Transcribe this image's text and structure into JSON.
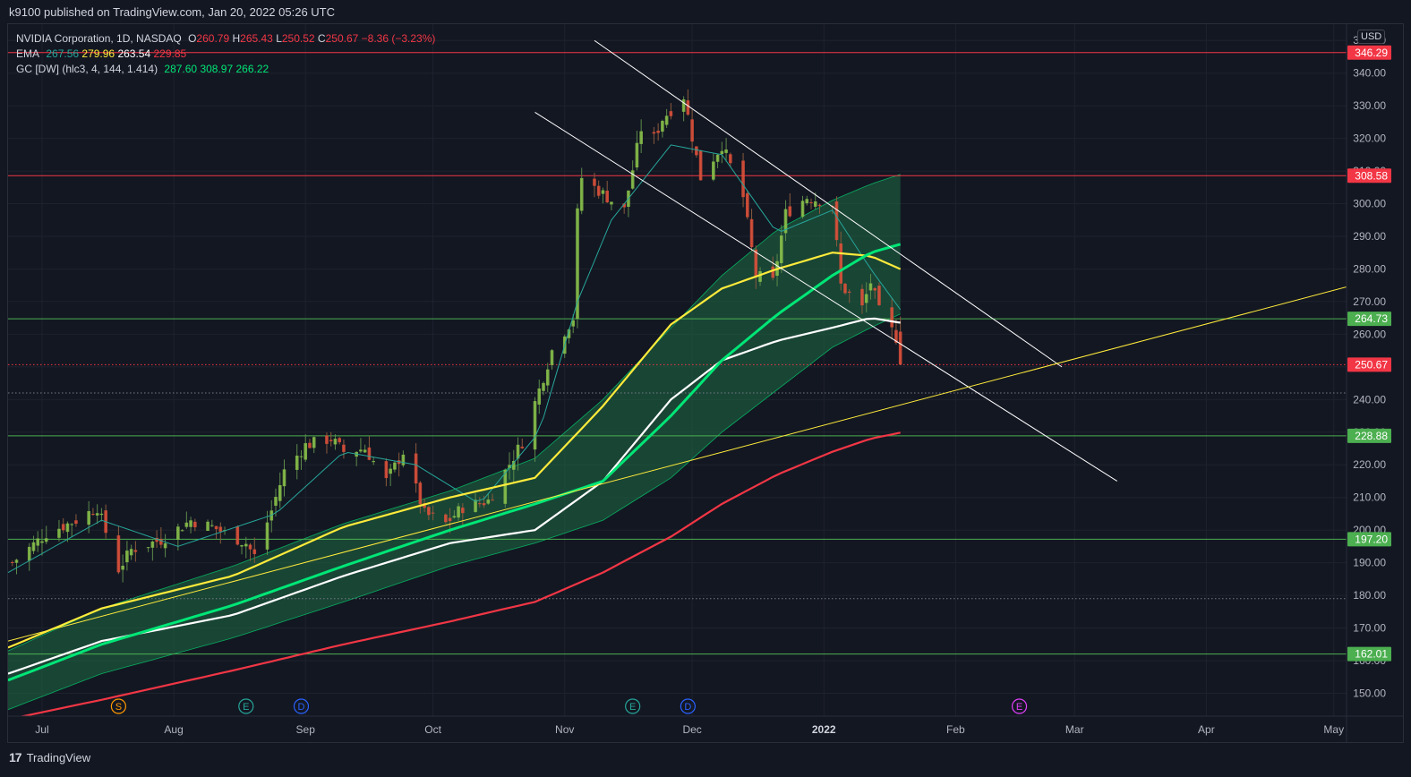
{
  "publish_line": "k9100 published on TradingView.com, Jan 20, 2022 05:26 UTC",
  "currency_badge": "USD",
  "legend": {
    "symbol_line": {
      "name": "NVIDIA Corporation, 1D, NASDAQ",
      "open_label": "O",
      "open": "260.79",
      "high_label": "H",
      "high": "265.43",
      "low_label": "L",
      "low": "250.52",
      "close_label": "C",
      "close": "250.67",
      "change": "−8.36 (−3.23%)"
    },
    "ema": {
      "label": "EMA",
      "values": [
        "267.56",
        "279.96",
        "263.54",
        "229.85"
      ]
    },
    "gc": {
      "label": "GC [DW] (hlc3, 4, 144, 1.414)",
      "values": [
        "287.60",
        "308.97",
        "266.22"
      ]
    }
  },
  "colors": {
    "up": "#4caf50",
    "down": "#f23645",
    "ema_fast": "#26a69a",
    "ema_yellow": "#ffeb3b",
    "ema_white": "#ffffff",
    "ema_red": "#f23645",
    "gc_mid": "#00e676",
    "band_fill": "#1b5e3a",
    "hline_red": "#f23645",
    "hline_green": "#4caf50",
    "trend_white": "#ffffff",
    "trend_yellow": "#ffeb3b"
  },
  "footer": {
    "brand": "TradingView"
  },
  "chart_data": {
    "type": "candlestick",
    "y_axis": {
      "range": [
        143,
        355
      ],
      "ticks": [
        "150.00",
        "160.00",
        "170.00",
        "180.00",
        "190.00",
        "200.00",
        "210.00",
        "220.00",
        "230.00",
        "240.00",
        "250.00",
        "260.00",
        "270.00",
        "280.00",
        "290.00",
        "300.00",
        "310.00",
        "320.00",
        "330.00",
        "340.00",
        "350.00"
      ],
      "tick_values": [
        150,
        160,
        170,
        180,
        190,
        200,
        210,
        220,
        230,
        240,
        250,
        260,
        270,
        280,
        290,
        300,
        310,
        320,
        330,
        340,
        350
      ]
    },
    "x_axis": {
      "labels": [
        "Jul",
        "Aug",
        "Sep",
        "Oct",
        "Nov",
        "Dec",
        "2022",
        "Feb",
        "Mar",
        "Apr",
        "May"
      ],
      "label_dates": [
        "2021-07-01",
        "2021-08-01",
        "2021-09-01",
        "2021-10-01",
        "2021-11-01",
        "2021-12-01",
        "2022-01-01",
        "2022-02-01",
        "2022-03-01",
        "2022-04-01",
        "2022-05-01"
      ],
      "range": [
        "2021-06-23",
        "2022-05-04"
      ]
    },
    "price_labels": [
      {
        "value": 346.29,
        "text": "346.29",
        "color": "#f23645"
      },
      {
        "value": 308.58,
        "text": "308.58",
        "color": "#f23645"
      },
      {
        "value": 264.73,
        "text": "264.73",
        "color": "#4caf50"
      },
      {
        "value": 250.67,
        "text": "250.67",
        "color": "#f23645"
      },
      {
        "value": 228.88,
        "text": "228.88",
        "color": "#4caf50"
      },
      {
        "value": 197.2,
        "text": "197.20",
        "color": "#4caf50"
      },
      {
        "value": 162.01,
        "text": "162.01",
        "color": "#4caf50"
      }
    ],
    "horizontal_lines": [
      {
        "value": 346.29,
        "color": "#f23645",
        "style": "solid"
      },
      {
        "value": 308.58,
        "color": "#f23645",
        "style": "solid"
      },
      {
        "value": 264.73,
        "color": "#4caf50",
        "style": "solid"
      },
      {
        "value": 250.67,
        "color": "#f23645",
        "style": "dotted"
      },
      {
        "value": 228.88,
        "color": "#4caf50",
        "style": "solid"
      },
      {
        "value": 197.2,
        "color": "#4caf50",
        "style": "solid"
      },
      {
        "value": 162.01,
        "color": "#4caf50",
        "style": "solid"
      },
      {
        "value": 242,
        "color": "#787b86",
        "style": "dotted"
      },
      {
        "value": 179,
        "color": "#787b86",
        "style": "dotted"
      }
    ],
    "trend_lines": [
      {
        "from": [
          "2021-11-08",
          350
        ],
        "to": [
          "2022-02-26",
          250
        ],
        "color": "#ffffff"
      },
      {
        "from": [
          "2021-10-25",
          328
        ],
        "to": [
          "2022-03-11",
          215
        ],
        "color": "#ffffff"
      },
      {
        "from": [
          "2021-06-23",
          166
        ],
        "to": [
          "2022-05-04",
          274.5
        ],
        "color": "#ffeb3b"
      }
    ],
    "close_anchors": [
      [
        "2021-06-24",
        190
      ],
      [
        "2021-07-02",
        199
      ],
      [
        "2021-07-09",
        203
      ],
      [
        "2021-07-14",
        207
      ],
      [
        "2021-07-19",
        188
      ],
      [
        "2021-07-22",
        194
      ],
      [
        "2021-07-29",
        197
      ],
      [
        "2021-08-05",
        203
      ],
      [
        "2021-08-10",
        201
      ],
      [
        "2021-08-18",
        196
      ],
      [
        "2021-08-20",
        192
      ],
      [
        "2021-08-24",
        206
      ],
      [
        "2021-08-27",
        218
      ],
      [
        "2021-09-01",
        226
      ],
      [
        "2021-09-07",
        228
      ],
      [
        "2021-09-10",
        224
      ],
      [
        "2021-09-15",
        225
      ],
      [
        "2021-09-20",
        215
      ],
      [
        "2021-09-24",
        224
      ],
      [
        "2021-09-29",
        205
      ],
      [
        "2021-10-04",
        202
      ],
      [
        "2021-10-08",
        207
      ],
      [
        "2021-10-14",
        209
      ],
      [
        "2021-10-18",
        218
      ],
      [
        "2021-10-22",
        227
      ],
      [
        "2021-10-29",
        255
      ],
      [
        "2021-11-03",
        265
      ],
      [
        "2021-11-04",
        297
      ],
      [
        "2021-11-05",
        308
      ],
      [
        "2021-11-10",
        303
      ],
      [
        "2021-11-15",
        298
      ],
      [
        "2021-11-19",
        323
      ],
      [
        "2021-11-22",
        320
      ],
      [
        "2021-11-24",
        326
      ],
      [
        "2021-11-29",
        333
      ],
      [
        "2021-12-03",
        308
      ],
      [
        "2021-12-08",
        318
      ],
      [
        "2021-12-13",
        302
      ],
      [
        "2021-12-16",
        278
      ],
      [
        "2021-12-20",
        276
      ],
      [
        "2021-12-23",
        297
      ],
      [
        "2021-12-28",
        302
      ],
      [
        "2022-01-03",
        300
      ],
      [
        "2022-01-05",
        275
      ],
      [
        "2022-01-10",
        268
      ],
      [
        "2022-01-12",
        276
      ],
      [
        "2022-01-14",
        267
      ],
      [
        "2022-01-18",
        259
      ],
      [
        "2022-01-19",
        250.67
      ]
    ],
    "ema_series": [
      {
        "name": "EMA 1",
        "color": "#26a69a",
        "values": [
          [
            "2021-06-23",
            187
          ],
          [
            "2021-07-15",
            203
          ],
          [
            "2021-08-02",
            195
          ],
          [
            "2021-08-25",
            205
          ],
          [
            "2021-09-10",
            224
          ],
          [
            "2021-09-27",
            220
          ],
          [
            "2021-10-12",
            208
          ],
          [
            "2021-10-26",
            230
          ],
          [
            "2021-11-04",
            270
          ],
          [
            "2021-11-12",
            295
          ],
          [
            "2021-11-26",
            318
          ],
          [
            "2021-12-08",
            315
          ],
          [
            "2021-12-21",
            291
          ],
          [
            "2022-01-03",
            298
          ],
          [
            "2022-01-12",
            280
          ],
          [
            "2022-01-19",
            267.56
          ]
        ]
      },
      {
        "name": "EMA 2",
        "color": "#ffeb3b",
        "values": [
          [
            "2021-06-23",
            164
          ],
          [
            "2021-07-15",
            176
          ],
          [
            "2021-08-15",
            186
          ],
          [
            "2021-09-10",
            201
          ],
          [
            "2021-10-05",
            210
          ],
          [
            "2021-10-25",
            216
          ],
          [
            "2021-11-10",
            238
          ],
          [
            "2021-11-26",
            263
          ],
          [
            "2021-12-08",
            274
          ],
          [
            "2021-12-21",
            280
          ],
          [
            "2022-01-03",
            285
          ],
          [
            "2022-01-12",
            284
          ],
          [
            "2022-01-19",
            279.96
          ]
        ]
      },
      {
        "name": "EMA 3",
        "color": "#ffffff",
        "values": [
          [
            "2021-06-23",
            156
          ],
          [
            "2021-07-15",
            166
          ],
          [
            "2021-08-15",
            174
          ],
          [
            "2021-09-10",
            186
          ],
          [
            "2021-10-05",
            196
          ],
          [
            "2021-10-25",
            200
          ],
          [
            "2021-11-10",
            215
          ],
          [
            "2021-11-26",
            240
          ],
          [
            "2021-12-08",
            252
          ],
          [
            "2021-12-21",
            258
          ],
          [
            "2022-01-03",
            262
          ],
          [
            "2022-01-12",
            265
          ],
          [
            "2022-01-19",
            263.54
          ]
        ]
      },
      {
        "name": "EMA 4",
        "color": "#f23645",
        "values": [
          [
            "2021-06-23",
            142
          ],
          [
            "2021-07-15",
            148
          ],
          [
            "2021-08-15",
            157
          ],
          [
            "2021-09-10",
            165
          ],
          [
            "2021-10-05",
            172
          ],
          [
            "2021-10-25",
            178
          ],
          [
            "2021-11-10",
            187
          ],
          [
            "2021-11-26",
            198
          ],
          [
            "2021-12-08",
            208
          ],
          [
            "2021-12-21",
            217
          ],
          [
            "2022-01-03",
            224
          ],
          [
            "2022-01-12",
            228
          ],
          [
            "2022-01-19",
            229.85
          ]
        ]
      }
    ],
    "gc_band": {
      "mid_color": "#00e676",
      "upper": [
        [
          "2021-06-23",
          163
        ],
        [
          "2021-07-15",
          176
        ],
        [
          "2021-08-15",
          189
        ],
        [
          "2021-09-10",
          202
        ],
        [
          "2021-10-05",
          212
        ],
        [
          "2021-10-25",
          222
        ],
        [
          "2021-11-10",
          240
        ],
        [
          "2021-11-26",
          262
        ],
        [
          "2021-12-08",
          278
        ],
        [
          "2021-12-21",
          292
        ],
        [
          "2022-01-03",
          301
        ],
        [
          "2022-01-12",
          306
        ],
        [
          "2022-01-19",
          308.97
        ]
      ],
      "mid": [
        [
          "2021-06-23",
          154
        ],
        [
          "2021-07-15",
          165
        ],
        [
          "2021-08-15",
          177
        ],
        [
          "2021-09-10",
          189
        ],
        [
          "2021-10-05",
          200
        ],
        [
          "2021-10-25",
          208
        ],
        [
          "2021-11-10",
          215
        ],
        [
          "2021-11-26",
          235
        ],
        [
          "2021-12-08",
          252
        ],
        [
          "2021-12-21",
          266
        ],
        [
          "2022-01-03",
          278
        ],
        [
          "2022-01-12",
          285
        ],
        [
          "2022-01-19",
          287.6
        ]
      ],
      "lower": [
        [
          "2021-06-23",
          145
        ],
        [
          "2021-07-15",
          156
        ],
        [
          "2021-08-15",
          167
        ],
        [
          "2021-09-10",
          178
        ],
        [
          "2021-10-05",
          189
        ],
        [
          "2021-10-25",
          196
        ],
        [
          "2021-11-10",
          203
        ],
        [
          "2021-11-26",
          216
        ],
        [
          "2021-12-08",
          230
        ],
        [
          "2021-12-21",
          243
        ],
        [
          "2022-01-03",
          256
        ],
        [
          "2022-01-12",
          262
        ],
        [
          "2022-01-19",
          266.22
        ]
      ]
    },
    "event_markers": [
      {
        "date": "2021-07-19",
        "text": "S",
        "color": "#ff9800"
      },
      {
        "date": "2021-08-18",
        "text": "E",
        "color": "#26a69a"
      },
      {
        "date": "2021-08-31",
        "text": "D",
        "color": "#2962ff"
      },
      {
        "date": "2021-11-17",
        "text": "E",
        "color": "#26a69a"
      },
      {
        "date": "2021-11-30",
        "text": "D",
        "color": "#2962ff"
      },
      {
        "date": "2022-02-16",
        "text": "E",
        "color": "#e040fb"
      }
    ]
  }
}
